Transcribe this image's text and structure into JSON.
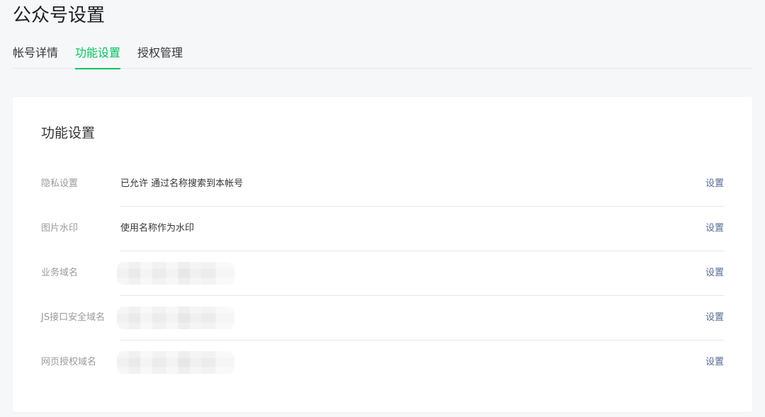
{
  "page": {
    "title": "公众号设置"
  },
  "tabs": [
    {
      "label": "帐号详情",
      "active": false
    },
    {
      "label": "功能设置",
      "active": true
    },
    {
      "label": "授权管理",
      "active": false
    }
  ],
  "accent_color": "#07c160",
  "link_color": "#576b95",
  "card": {
    "title": "功能设置",
    "rows": [
      {
        "label": "隐私设置",
        "value": "已允许 通过名称搜索到本帐号",
        "action": "设置"
      },
      {
        "label": "图片水印",
        "value": "使用名称作为水印",
        "action": "设置"
      },
      {
        "label": "业务域名",
        "value": "",
        "action": "设置",
        "redacted": true
      },
      {
        "label": "JS接口安全域名",
        "value": "",
        "action": "设置",
        "redacted": true
      },
      {
        "label": "网页授权域名",
        "value": "",
        "action": "设置",
        "redacted": true
      }
    ]
  }
}
